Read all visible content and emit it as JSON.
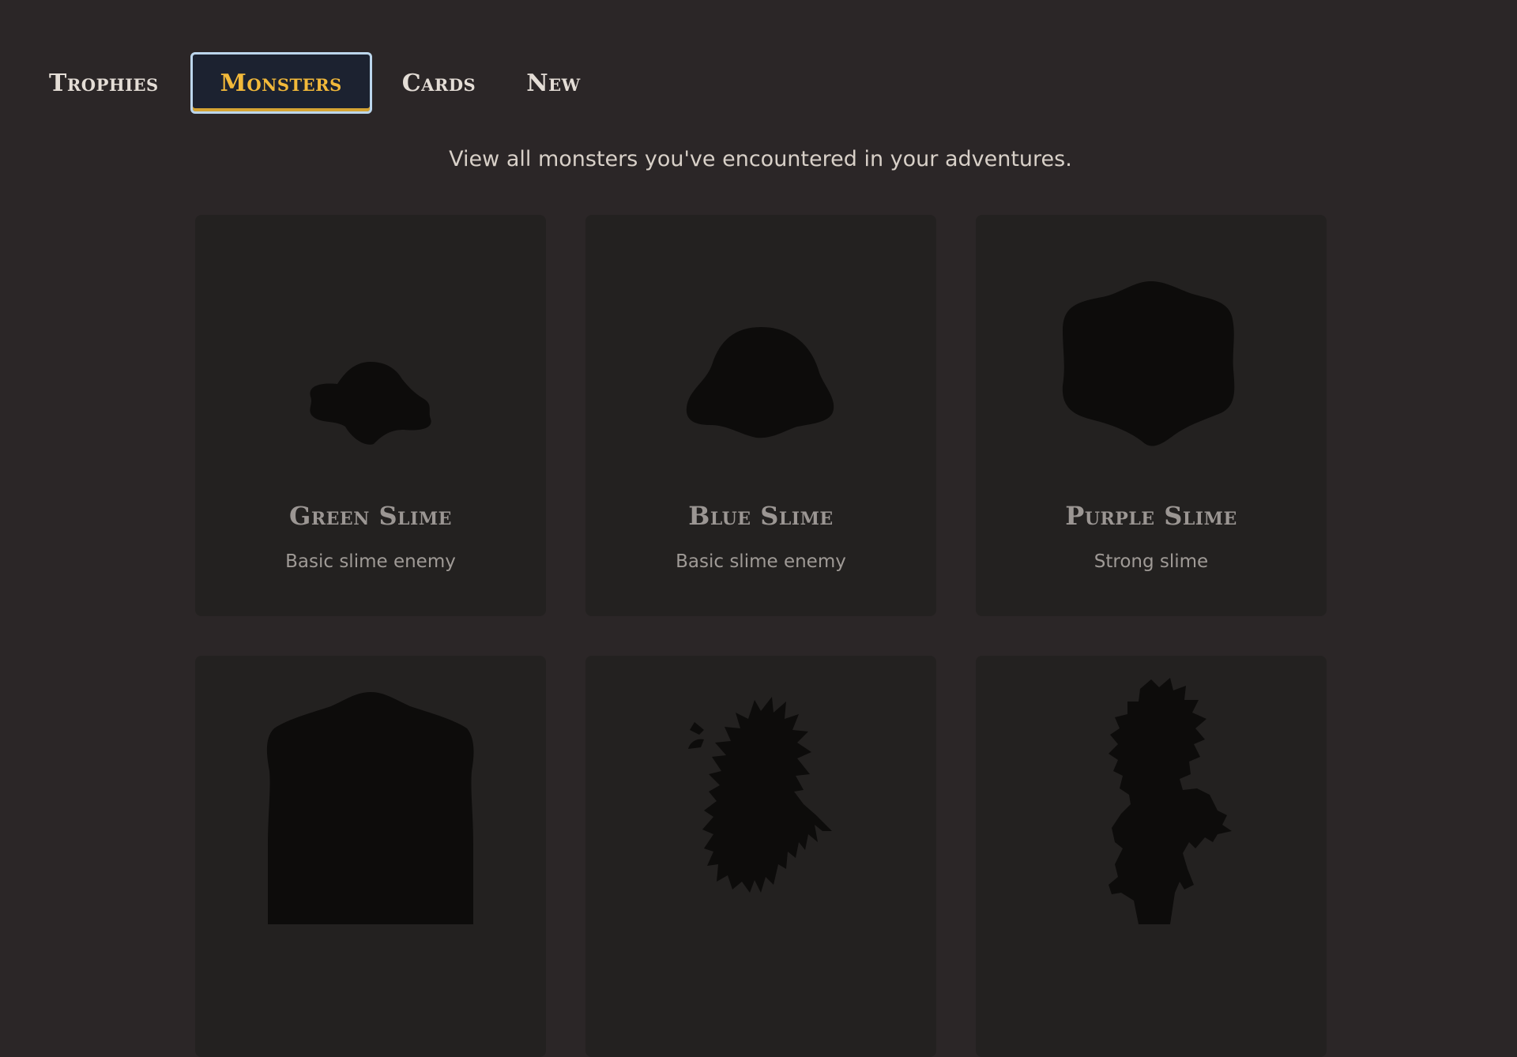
{
  "tabs": [
    {
      "label": "Trophies"
    },
    {
      "label": "Monsters"
    },
    {
      "label": "Cards"
    },
    {
      "label": "New"
    }
  ],
  "active_tab": "Monsters",
  "subtitle": "View all monsters you've encountered in your adventures.",
  "monsters": [
    {
      "name": "Green Slime",
      "description": "Basic slime enemy",
      "icon": "green-slime-silhouette-icon"
    },
    {
      "name": "Blue Slime",
      "description": "Basic slime enemy",
      "icon": "blue-slime-silhouette-icon"
    },
    {
      "name": "Purple Slime",
      "description": "Strong slime",
      "icon": "purple-slime-silhouette-icon"
    },
    {
      "name": "",
      "description": "",
      "icon": "large-slime-silhouette-icon"
    },
    {
      "name": "",
      "description": "",
      "icon": "furry-beast-silhouette-icon"
    },
    {
      "name": "",
      "description": "",
      "icon": "goblin-silhouette-icon"
    }
  ],
  "colors": {
    "background": "#2b2627",
    "card": "#232120",
    "silhouette": "#0d0c0b",
    "active_tab_text": "#f2b93a",
    "active_tab_border": "#bcd6ec"
  }
}
